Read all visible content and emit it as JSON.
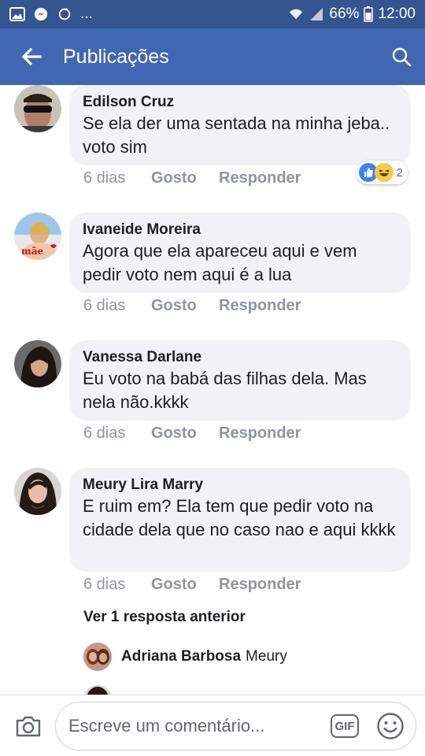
{
  "status_bar": {
    "notification_icons": [
      "image-icon",
      "messenger-icon",
      "sync-icon"
    ],
    "more_indicator": "...",
    "battery_percent": "66%",
    "time": "12:00"
  },
  "app_bar": {
    "title": "Publicações"
  },
  "comments": [
    {
      "author": "Edilson Cruz",
      "text": "Se ela der uma sentada na minha jeba.. voto sim",
      "time": "6 dias",
      "like_label": "Gosto",
      "reply_label": "Responder",
      "reaction_icons": [
        "like-reaction",
        "haha-reaction"
      ],
      "reaction_count": "2"
    },
    {
      "author": "Ivaneide Moreira",
      "text": "Agora que ela apareceu aqui e vem pedir voto nem aqui é a lua",
      "time": "6 dias",
      "like_label": "Gosto",
      "reply_label": "Responder",
      "avatar_text": "mãe"
    },
    {
      "author": "Vanessa Darlane",
      "text": "Eu voto na babá das filhas dela. Mas nela não.kkkk",
      "time": "6 dias",
      "like_label": "Gosto",
      "reply_label": "Responder"
    },
    {
      "author": "Meury Lira Marry",
      "text": "E ruim em? Ela tem que pedir voto na cidade dela que no caso nao e aqui kkkk",
      "time": "6 dias",
      "like_label": "Gosto",
      "reply_label": "Responder"
    }
  ],
  "replies": {
    "previous_label": "Ver 1 resposta anterior",
    "items": [
      {
        "author": "Adriana Barbosa",
        "snippet": "Meury"
      }
    ]
  },
  "composer": {
    "placeholder": "Escreve um comentário...",
    "gif_label": "GIF",
    "icons": [
      "camera-icon",
      "gif-icon",
      "emoji-icon"
    ]
  },
  "colors": {
    "status_bar": "#34558f",
    "app_bar": "#4267b2",
    "bubble": "#f0f2f5",
    "meta_text": "#90949c"
  }
}
